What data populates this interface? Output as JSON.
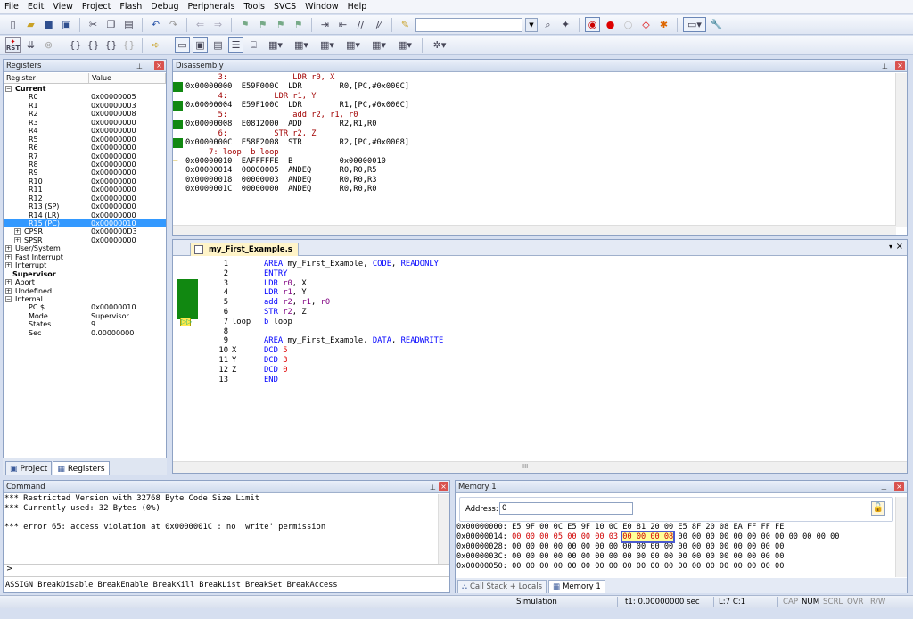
{
  "menu": [
    "File",
    "Edit",
    "View",
    "Project",
    "Flash",
    "Debug",
    "Peripherals",
    "Tools",
    "SVCS",
    "Window",
    "Help"
  ],
  "toolbar1": {
    "icons": [
      "new-file-icon",
      "open-folder-icon",
      "save-icon",
      "save-all-icon",
      "cut-icon",
      "copy-icon",
      "paste-icon",
      "undo-icon",
      "redo-icon",
      "nav-back-icon",
      "nav-forward-icon",
      "bookmark-icon",
      "bookmark-prev-icon",
      "bookmark-next-icon",
      "bookmark-clear-icon",
      "indent-icon",
      "unindent-icon",
      "comment-icon",
      "uncomment-icon",
      "find-in-files-icon",
      "find-combo",
      "find-icon",
      "debug-session-icon",
      "debug-start-icon",
      "breakpoint-icon",
      "breakpoint-disable-icon",
      "breakpoint-kill-icon",
      "breakpoint-manager-icon",
      "window-layout-icon",
      "configure-icon"
    ]
  },
  "toolbar2": {
    "rst_label": "RST"
  },
  "registers": {
    "title": "Registers",
    "col_register": "Register",
    "col_value": "Value",
    "rows": [
      {
        "name": "Current",
        "value": "",
        "level": 0,
        "tree": "−",
        "bold": true
      },
      {
        "name": "R0",
        "value": "0x00000005",
        "level": 2
      },
      {
        "name": "R1",
        "value": "0x00000003",
        "level": 2
      },
      {
        "name": "R2",
        "value": "0x00000008",
        "level": 2
      },
      {
        "name": "R3",
        "value": "0x00000000",
        "level": 2
      },
      {
        "name": "R4",
        "value": "0x00000000",
        "level": 2
      },
      {
        "name": "R5",
        "value": "0x00000000",
        "level": 2
      },
      {
        "name": "R6",
        "value": "0x00000000",
        "level": 2
      },
      {
        "name": "R7",
        "value": "0x00000000",
        "level": 2
      },
      {
        "name": "R8",
        "value": "0x00000000",
        "level": 2
      },
      {
        "name": "R9",
        "value": "0x00000000",
        "level": 2
      },
      {
        "name": "R10",
        "value": "0x00000000",
        "level": 2
      },
      {
        "name": "R11",
        "value": "0x00000000",
        "level": 2
      },
      {
        "name": "R12",
        "value": "0x00000000",
        "level": 2
      },
      {
        "name": "R13 (SP)",
        "value": "0x00000000",
        "level": 2
      },
      {
        "name": "R14 (LR)",
        "value": "0x00000000",
        "level": 2
      },
      {
        "name": "R15 (PC)",
        "value": "0x00000010",
        "level": 2,
        "selected": true
      },
      {
        "name": "CPSR",
        "value": "0x000000D3",
        "level": 1,
        "tree": "+"
      },
      {
        "name": "SPSR",
        "value": "0x00000000",
        "level": 1,
        "tree": "+"
      },
      {
        "name": "User/System",
        "value": "",
        "level": 0,
        "tree": "+"
      },
      {
        "name": "Fast Interrupt",
        "value": "",
        "level": 0,
        "tree": "+"
      },
      {
        "name": "Interrupt",
        "value": "",
        "level": 0,
        "tree": "+"
      },
      {
        "name": "Supervisor",
        "value": "",
        "level": 0,
        "bold": true
      },
      {
        "name": "Abort",
        "value": "",
        "level": 0,
        "tree": "+"
      },
      {
        "name": "Undefined",
        "value": "",
        "level": 0,
        "tree": "+"
      },
      {
        "name": "Internal",
        "value": "",
        "level": 0,
        "tree": "−"
      },
      {
        "name": "PC  $",
        "value": "0x00000010",
        "level": 2
      },
      {
        "name": "Mode",
        "value": "Supervisor",
        "level": 2
      },
      {
        "name": "States",
        "value": "9",
        "level": 2
      },
      {
        "name": "Sec",
        "value": "0.00000000",
        "level": 2
      }
    ],
    "tabs": [
      {
        "label": "Project"
      },
      {
        "label": "Registers",
        "active": true
      }
    ]
  },
  "disassembly": {
    "title": "Disassembly",
    "lines": [
      {
        "text": "       3:              LDR r0, X",
        "src": true
      },
      {
        "text": "0x00000000  E59F000C  LDR        R0,[PC,#0x000C]",
        "mark": true
      },
      {
        "text": "       4:          LDR r1, Y",
        "src": true
      },
      {
        "text": "0x00000004  E59F100C  LDR        R1,[PC,#0x000C]",
        "mark": true
      },
      {
        "text": "       5:              add r2, r1, r0",
        "src": true
      },
      {
        "text": "0x00000008  E0812000  ADD        R2,R1,R0",
        "mark": true
      },
      {
        "text": "       6:          STR r2, Z",
        "src": true
      },
      {
        "text": "0x0000000C  E58F2008  STR        R2,[PC,#0x0008]",
        "mark": true
      },
      {
        "text": "     7: loop  b loop",
        "src": true
      },
      {
        "text": "0x00000010  EAFFFFFE  B          0x00000010",
        "arrow": true
      },
      {
        "text": "0x00000014  00000005  ANDEQ      R0,R0,R5"
      },
      {
        "text": "0x00000018  00000003  ANDEQ      R0,R0,R3"
      },
      {
        "text": "0x0000001C  00000000  ANDEQ      R0,R0,R0"
      }
    ]
  },
  "editor": {
    "tab": "my_First_Example.s",
    "lines": [
      {
        "n": "1",
        "label": "",
        "code": "AREA my_First_Example, CODE, READONLY"
      },
      {
        "n": "2",
        "label": "",
        "code": "ENTRY"
      },
      {
        "n": "3",
        "label": "",
        "code": "LDR r0, X"
      },
      {
        "n": "4",
        "label": "",
        "code": "LDR r1, Y"
      },
      {
        "n": "5",
        "label": "",
        "code": "add r2, r1, r0"
      },
      {
        "n": "6",
        "label": "",
        "code": "STR r2, Z"
      },
      {
        "n": "7",
        "label": "loop",
        "code": "b loop"
      },
      {
        "n": "8",
        "label": "",
        "code": ""
      },
      {
        "n": "9",
        "label": "",
        "code": "AREA my_First_Example, DATA, READWRITE"
      },
      {
        "n": "10",
        "label": "X",
        "code": "DCD 5"
      },
      {
        "n": "11",
        "label": "Y",
        "code": "DCD 3"
      },
      {
        "n": "12",
        "label": "Z",
        "code": "DCD 0"
      },
      {
        "n": "13",
        "label": "",
        "code": "END"
      }
    ],
    "scroll_mark": "III"
  },
  "command": {
    "title": "Command",
    "lines": [
      "*** Restricted Version with 32768 Byte Code Size Limit",
      "*** Currently used: 32 Bytes (0%)",
      "",
      "*** error 65: access violation at 0x0000001C : no 'write' permission"
    ],
    "prompt": ">",
    "hint": "ASSIGN BreakDisable BreakEnable BreakKill BreakList BreakSet BreakAccess"
  },
  "memory": {
    "title": "Memory 1",
    "address_label": "Address:",
    "address_value": "0",
    "lines": [
      {
        "addr": "0x00000000:",
        "pre": "E5 9F 00 0C E5 9F 10 0C E0 81 20 00 E5 8F 20 08 EA FF FF FE",
        "hl": "",
        "post": "",
        "red": false
      },
      {
        "addr": "0x00000014:",
        "pre": "00 00 00 05 00 00 00 03 ",
        "hl": "00 00 00 08",
        "post": " 00 00 00 00 00 00 00 00 00 00 00 00",
        "red": true
      },
      {
        "addr": "0x00000028:",
        "pre": "00 00 00 00 00 00 00 00 00 00 00 00 00 00 00 00 00 00 00 00",
        "hl": "",
        "post": "",
        "red": false
      },
      {
        "addr": "0x0000003C:",
        "pre": "00 00 00 00 00 00 00 00 00 00 00 00 00 00 00 00 00 00 00 00",
        "hl": "",
        "post": "",
        "red": false
      },
      {
        "addr": "0x00000050:",
        "pre": "00 00 00 00 00 00 00 00 00 00 00 00 00 00 00 00 00 00 00 00",
        "hl": "",
        "post": "",
        "red": false
      }
    ],
    "tabs": [
      {
        "label": "Call Stack + Locals"
      },
      {
        "label": "Memory 1",
        "active": true
      }
    ]
  },
  "status": {
    "mode": "Simulation",
    "time": "t1: 0.00000000 sec",
    "pos": "L:7 C:1",
    "cap": "CAP",
    "num": "NUM",
    "scrl": "SCRL",
    "ovr": "OVR",
    "rw": "R/W"
  }
}
